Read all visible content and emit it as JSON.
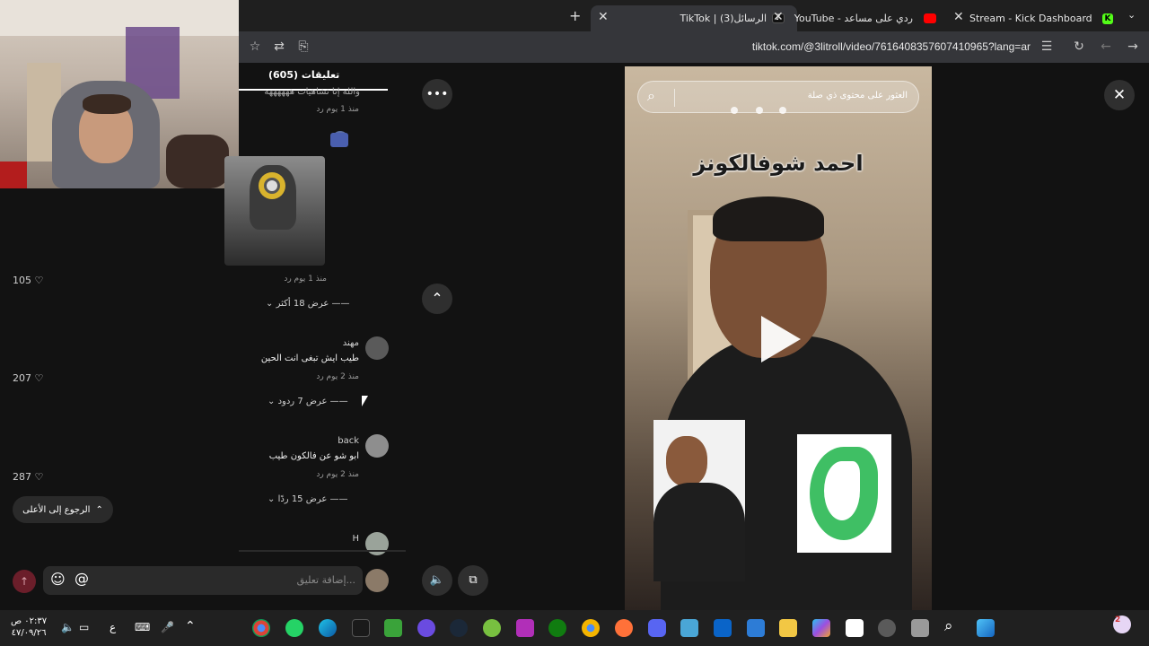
{
  "tabs": [
    {
      "title": "Stream - Kick Dashboard",
      "active": false
    },
    {
      "title": "YouTube - ردي على مساعد",
      "active": false
    },
    {
      "title": "TikTok | الرسائل(3)",
      "active": true
    }
  ],
  "new_tab_symbol": "+",
  "address": {
    "url": "tiktok.com/@3litroll/video/7616408357607410965?lang=ar"
  },
  "comments_panel": {
    "header": "(605) تعليقات",
    "items": [
      {
        "text": "والله إنا تشاهيات ههههههه",
        "meta": "منذ 1 يوم   رد"
      },
      {
        "meta": "منذ 1 يوم   رد",
        "likes": "105",
        "view_replies": "عرض 18 أكثر"
      },
      {
        "name": "مهند",
        "text": "طيب ايش تبغى انت الحين",
        "meta": "منذ 2 يوم   رد",
        "likes": "207",
        "view_replies": "عرض 7 ردود"
      },
      {
        "name": "back",
        "text": "ابو شو عن فالكون طيب",
        "meta": "منذ 2 يوم   رد",
        "likes": "287",
        "view_replies": "عرض 15 ردًا"
      },
      {
        "name": "H"
      }
    ],
    "back_to_top": "الرجوع إلى الأعلى",
    "comment_placeholder": "إضافة تعليق..."
  },
  "video": {
    "search_placeholder": "العثور على محتوى ذي صلة",
    "caption": "احمد شوفالكونز"
  },
  "taskbar": {
    "time": "٠٢:٣٧ ص",
    "date": "٤٧/٠٩/٢٦",
    "lang": "ع",
    "notification_count": "2"
  },
  "colors": {
    "tiktok_red": "#fe2c55",
    "kick_green": "#53fc18",
    "youtube_red": "#ff0000"
  }
}
